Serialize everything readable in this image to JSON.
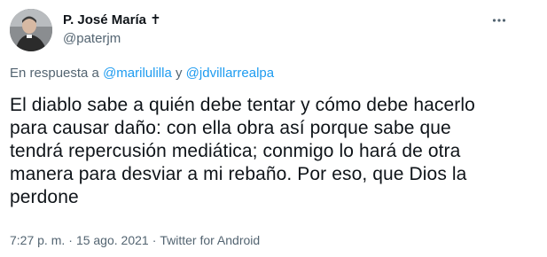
{
  "author": {
    "name": "P. José María",
    "badge": "✝",
    "handle": "@paterjm"
  },
  "more_icon": "ellipsis-horizontal-icon",
  "reply": {
    "prefix": "En respuesta a",
    "user1": "@marilulilla",
    "conjunction": "y",
    "user2": "@jdvillarrealpa"
  },
  "tweet": {
    "text": "El diablo sabe a quién debe tentar y cómo debe hacerlo\npara causar daño: con ella obra así porque sabe que\ntendrá repercusión mediática; conmigo lo hará de otra\nmanera para desviar a mi rebaño. Por eso, que Dios la\nperdone"
  },
  "meta": {
    "time": "7:27 p. m.",
    "separator": "·",
    "date": "15 ago. 2021",
    "source": "Twitter for Android"
  },
  "colors": {
    "text": "#0f1419",
    "secondary": "#536471",
    "link": "#1d9bf0"
  }
}
